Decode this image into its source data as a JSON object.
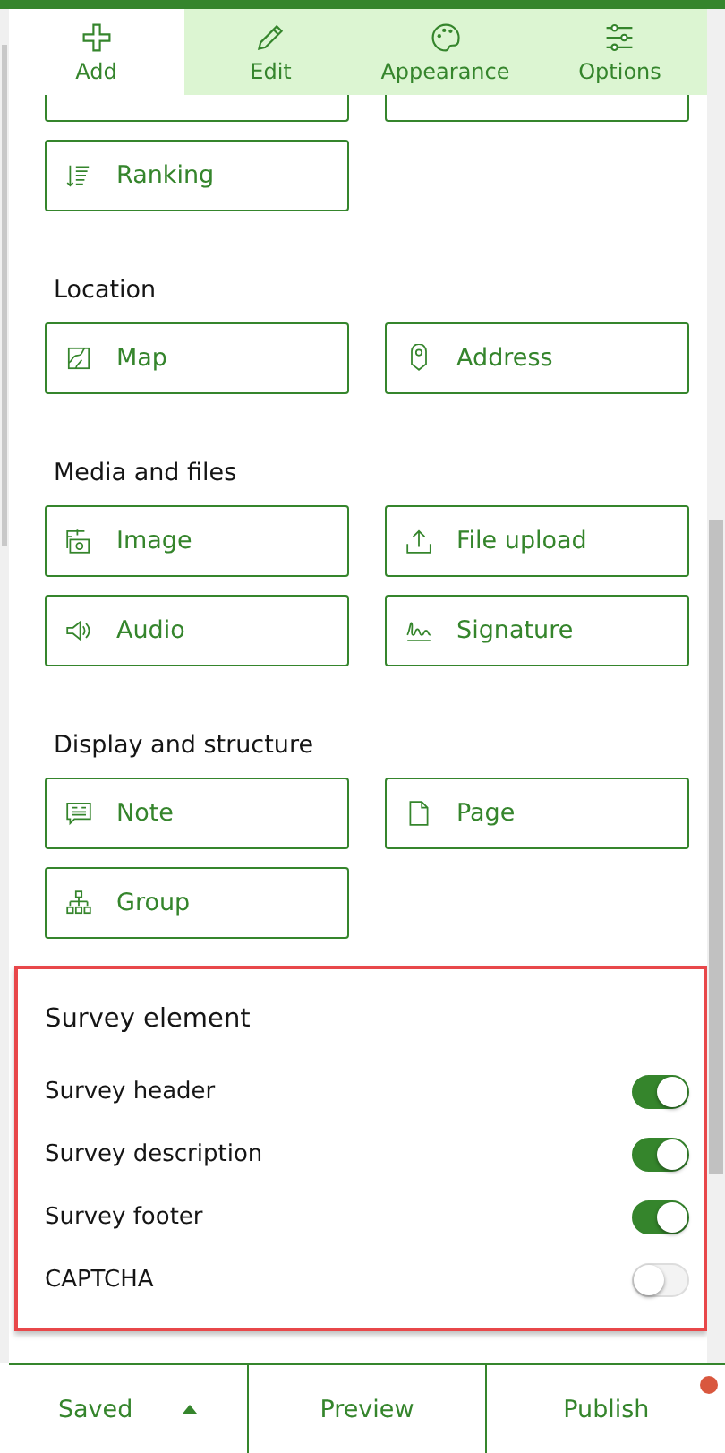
{
  "tabs": [
    {
      "label": "Add",
      "selected": true
    },
    {
      "label": "Edit",
      "selected": false
    },
    {
      "label": "Appearance",
      "selected": false
    },
    {
      "label": "Options",
      "selected": false
    }
  ],
  "sections": [
    {
      "items": [
        {
          "kind": "cut"
        },
        {
          "kind": "cut"
        },
        {
          "kind": "button",
          "label": "Ranking"
        }
      ]
    },
    {
      "title": "Location",
      "items": [
        {
          "kind": "button",
          "label": "Map"
        },
        {
          "kind": "button",
          "label": "Address"
        }
      ]
    },
    {
      "title": "Media and files",
      "items": [
        {
          "kind": "button",
          "label": "Image"
        },
        {
          "kind": "button",
          "label": "File upload"
        },
        {
          "kind": "button",
          "label": "Audio"
        },
        {
          "kind": "button",
          "label": "Signature"
        }
      ]
    },
    {
      "title": "Display and structure",
      "items": [
        {
          "kind": "button",
          "label": "Note"
        },
        {
          "kind": "button",
          "label": "Page"
        },
        {
          "kind": "button",
          "label": "Group"
        }
      ]
    }
  ],
  "survey_element": {
    "title": "Survey element",
    "toggles": [
      {
        "label": "Survey header",
        "on": true
      },
      {
        "label": "Survey description",
        "on": true
      },
      {
        "label": "Survey footer",
        "on": true
      },
      {
        "label": "CAPTCHA",
        "on": false
      }
    ]
  },
  "footer": {
    "saved": "Saved",
    "preview": "Preview",
    "publish": "Publish",
    "publish_notice": true
  }
}
